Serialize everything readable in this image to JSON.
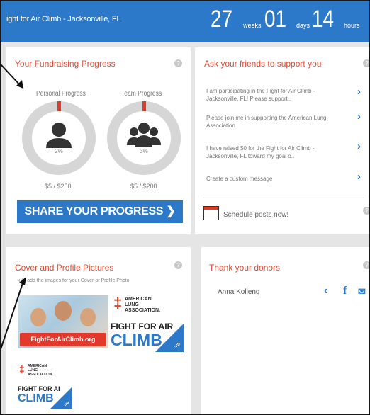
{
  "header": {
    "title": "ight for Air Climb - Jacksonville, FL",
    "countdown": [
      {
        "value": "27",
        "unit": "weeks"
      },
      {
        "value": "01",
        "unit": "days"
      },
      {
        "value": "14",
        "unit": "hours"
      }
    ]
  },
  "progress": {
    "title": "Your Fundraising Progress",
    "personal": {
      "label": "Personal Progress",
      "percent": "2%",
      "amount": "$5 / $250",
      "fraction": 0.02
    },
    "team": {
      "label": "Team Progress",
      "percent": "3%",
      "amount": "$5 / $200",
      "fraction": 0.03
    },
    "share_label": "SHARE YOUR PROGRESS ❯"
  },
  "friends": {
    "title": "Ask your friends to support you",
    "messages": [
      "I am participating in the Fight for Air Climb - Jacksonville, FL! Please support..",
      "Please join me in supporting the American Lung Association.",
      "I have raised $0 for the Fight for Air Climb - Jacksonville, FL toward my goal o..",
      "Create a custom message"
    ],
    "schedule_label": "Schedule posts now!"
  },
  "cover": {
    "title": "Cover and Profile Pictures",
    "instructions": "k to add the images for your Cover or Profile Photo",
    "photo_banner": "FightForAirClimb.org",
    "lung_lines": [
      "AMERICAN",
      "LUNG",
      "ASSOCIATION."
    ],
    "fight_text": "FIGHT FOR AIR",
    "climb_text": "CLIMB",
    "small_fight_text": "FIGHT FOR AI",
    "small_climb_text": "CLIMB"
  },
  "donors": {
    "title": "Thank your donors",
    "names": [
      "Anna Kolleng"
    ]
  },
  "colors": {
    "accent": "#2c79c9",
    "title_red": "#e14b34",
    "background": "#e5e5e5"
  },
  "icons": [
    "help-icon",
    "chevron-right-icon",
    "calendar-icon",
    "share-icon",
    "chevron-left-icon",
    "facebook-icon",
    "email-icon"
  ]
}
